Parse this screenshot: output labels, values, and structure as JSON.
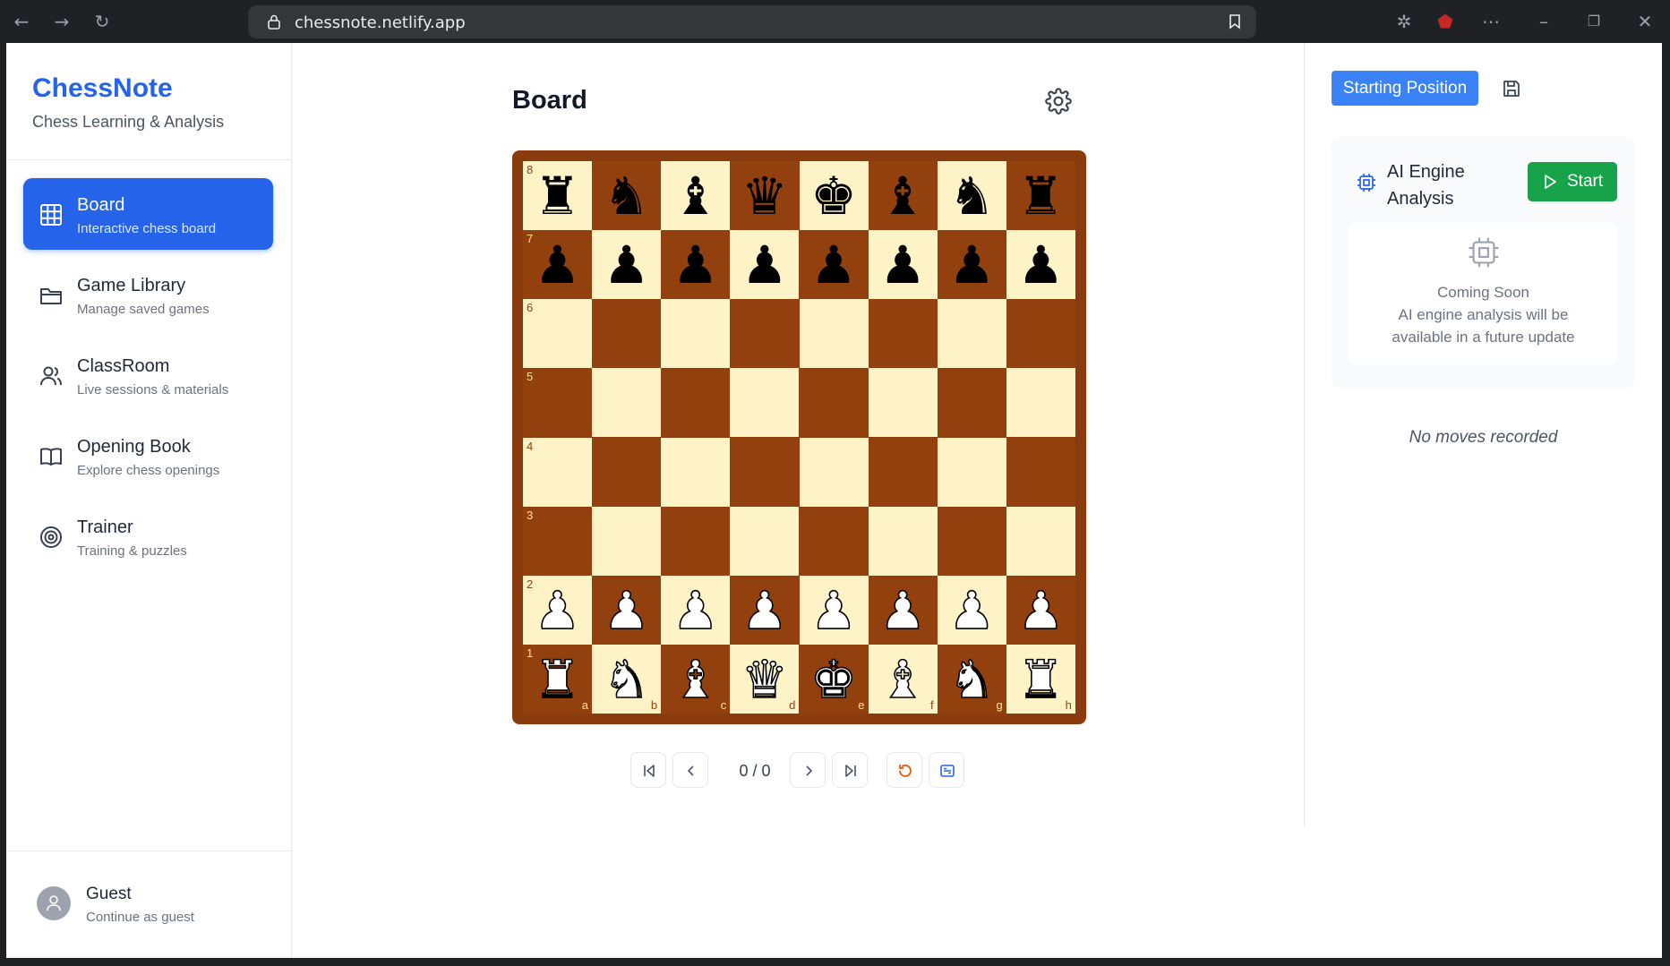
{
  "browser": {
    "url": "chessnote.netlify.app"
  },
  "sidebar": {
    "brand": "ChessNote",
    "tagline": "Chess Learning & Analysis",
    "items": [
      {
        "label": "Board",
        "sub": "Interactive chess board",
        "icon": "grid-icon",
        "active": true
      },
      {
        "label": "Game Library",
        "sub": "Manage saved games",
        "icon": "folder-icon"
      },
      {
        "label": "ClassRoom",
        "sub": "Live sessions & materials",
        "icon": "users-icon"
      },
      {
        "label": "Opening Book",
        "sub": "Explore chess openings",
        "icon": "book-icon"
      },
      {
        "label": "Trainer",
        "sub": "Training & puzzles",
        "icon": "target-icon"
      }
    ],
    "user": {
      "name": "Guest",
      "sub": "Continue as guest"
    }
  },
  "main": {
    "title": "Board",
    "board": {
      "ranks": [
        "8",
        "7",
        "6",
        "5",
        "4",
        "3",
        "2",
        "1"
      ],
      "files": [
        "a",
        "b",
        "c",
        "d",
        "e",
        "f",
        "g",
        "h"
      ],
      "position": [
        [
          "bR",
          "bN",
          "bB",
          "bQ",
          "bK",
          "bB",
          "bN",
          "bR"
        ],
        [
          "bP",
          "bP",
          "bP",
          "bP",
          "bP",
          "bP",
          "bP",
          "bP"
        ],
        [
          "",
          "",
          "",
          "",
          "",
          "",
          "",
          ""
        ],
        [
          "",
          "",
          "",
          "",
          "",
          "",
          "",
          ""
        ],
        [
          "",
          "",
          "",
          "",
          "",
          "",
          "",
          ""
        ],
        [
          "",
          "",
          "",
          "",
          "",
          "",
          "",
          ""
        ],
        [
          "wP",
          "wP",
          "wP",
          "wP",
          "wP",
          "wP",
          "wP",
          "wP"
        ],
        [
          "wR",
          "wN",
          "wB",
          "wQ",
          "wK",
          "wB",
          "wN",
          "wR"
        ]
      ],
      "colors": {
        "light": "#fef3c7",
        "dark": "#92400e",
        "frame": "#8b3c0f"
      }
    },
    "move_counter": "0 / 0"
  },
  "right": {
    "starting_position": "Starting Position",
    "ai": {
      "title": "AI Engine Analysis",
      "start": "Start",
      "soon_title": "Coming Soon",
      "soon_line1": "AI engine analysis will be",
      "soon_line2": "available in a future update"
    },
    "no_moves": "No moves recorded"
  },
  "colors": {
    "accent": "#2563eb",
    "start_green": "#16a34a"
  }
}
